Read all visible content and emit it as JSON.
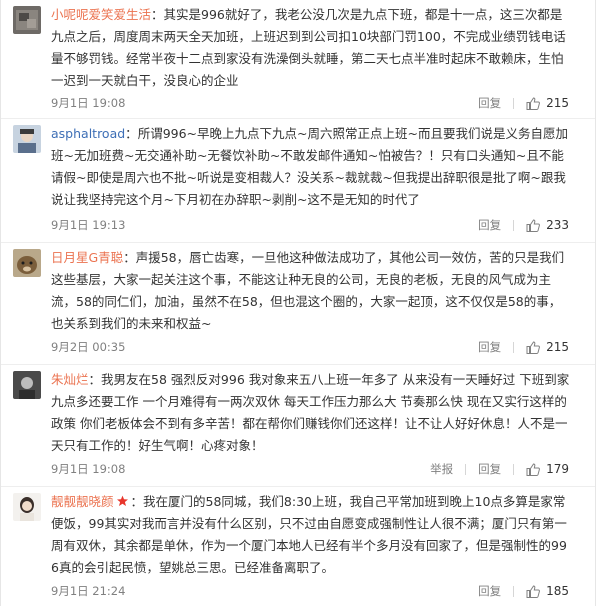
{
  "comments": [
    {
      "user": "小呢呢爱笑爱生活",
      "text": "其实是996就好了，我老公没几次是九点下班，都是十一点，这三次都是九点之后，周度周末两天全天加班，上班迟到到公司扣10块部门罚100，不完成业绩罚钱电话量不够罚钱。经常半夜十二点到家没有洗澡倒头就睡，第二天七点半准时起床不敢赖床，生怕一迟到一天就白干，没良心的企业",
      "time": "9月1日 19:08",
      "actions": [
        "回复"
      ],
      "likes": "215"
    },
    {
      "user": "asphaltroad",
      "text": "所谓996~早晚上九点下九点~周六照常正点上班~而且要我们说是义务自愿加班~无加班费~无交通补助~无餐饮补助~不敢发邮件通知~怕被告？！只有口头通知~且不能请假~即使是周六也不批~听说是变相裁人？没关系~裁就裁~但我提出辞职很是批了啊~跟我说让我坚持完这个月~下月初在办辞职~剥削~这不是无知的时代了",
      "time": "9月1日 19:13",
      "actions": [
        "回复"
      ],
      "likes": "233"
    },
    {
      "user": "日月星G青聪",
      "text": "声援58，唇亡齿寒，一旦他这种做法成功了，其他公司一效仿，苦的只是我们这些基层，大家一起关注这个事，不能这让种无良的公司，无良的老板，无良的风气成为主流，58的同仁们，加油，虽然不在58，但也混这个圈的，大家一起顶，这不仅仅是58的事，也关系到我们的未来和权益~",
      "time": "9月2日 00:35",
      "actions": [
        "回复"
      ],
      "likes": "215"
    },
    {
      "user": "朱灿烂",
      "text": "我男友在58 强烈反对996 我对象来五八上班一年多了 从来没有一天睡好过 下班到家九点多还要工作 一个月难得有一两次双休 每天工作压力那么大 节奏那么快 现在又实行这样的政策 你们老板体会不到有多辛苦！都在帮你们赚钱你们还这样！让不让人好好休息！人不是一天只有工作的！好生气啊！心疼对象！",
      "time": "9月1日 19:08",
      "actions": [
        "举报",
        "回复"
      ],
      "likes": "179"
    },
    {
      "user": "靓靓靓晓颜",
      "text": "我在厦门的58同城，我们8:30上班，我自己平常加班到晚上10点多算是家常便饭，99其实对我而言并没有什么区别，只不过由自愿变成强制性让人很不满；厦门只有第一周有双休，其余都是单休，作为一个厦门本地人已经有半个多月没有回家了，但是强制性的996真的会引起民愤，望姚总三思。已经准备离职了。",
      "time": "9月1日 21:24",
      "actions": [
        "回复"
      ],
      "likes": "185"
    }
  ],
  "colors": {
    "username_orange": "#eb7350",
    "username_blue": "#3e6fb6",
    "meta_gray": "#808080"
  },
  "icons": {
    "like": "thumbs-up-icon",
    "badge": "red-star-badge-icon"
  }
}
